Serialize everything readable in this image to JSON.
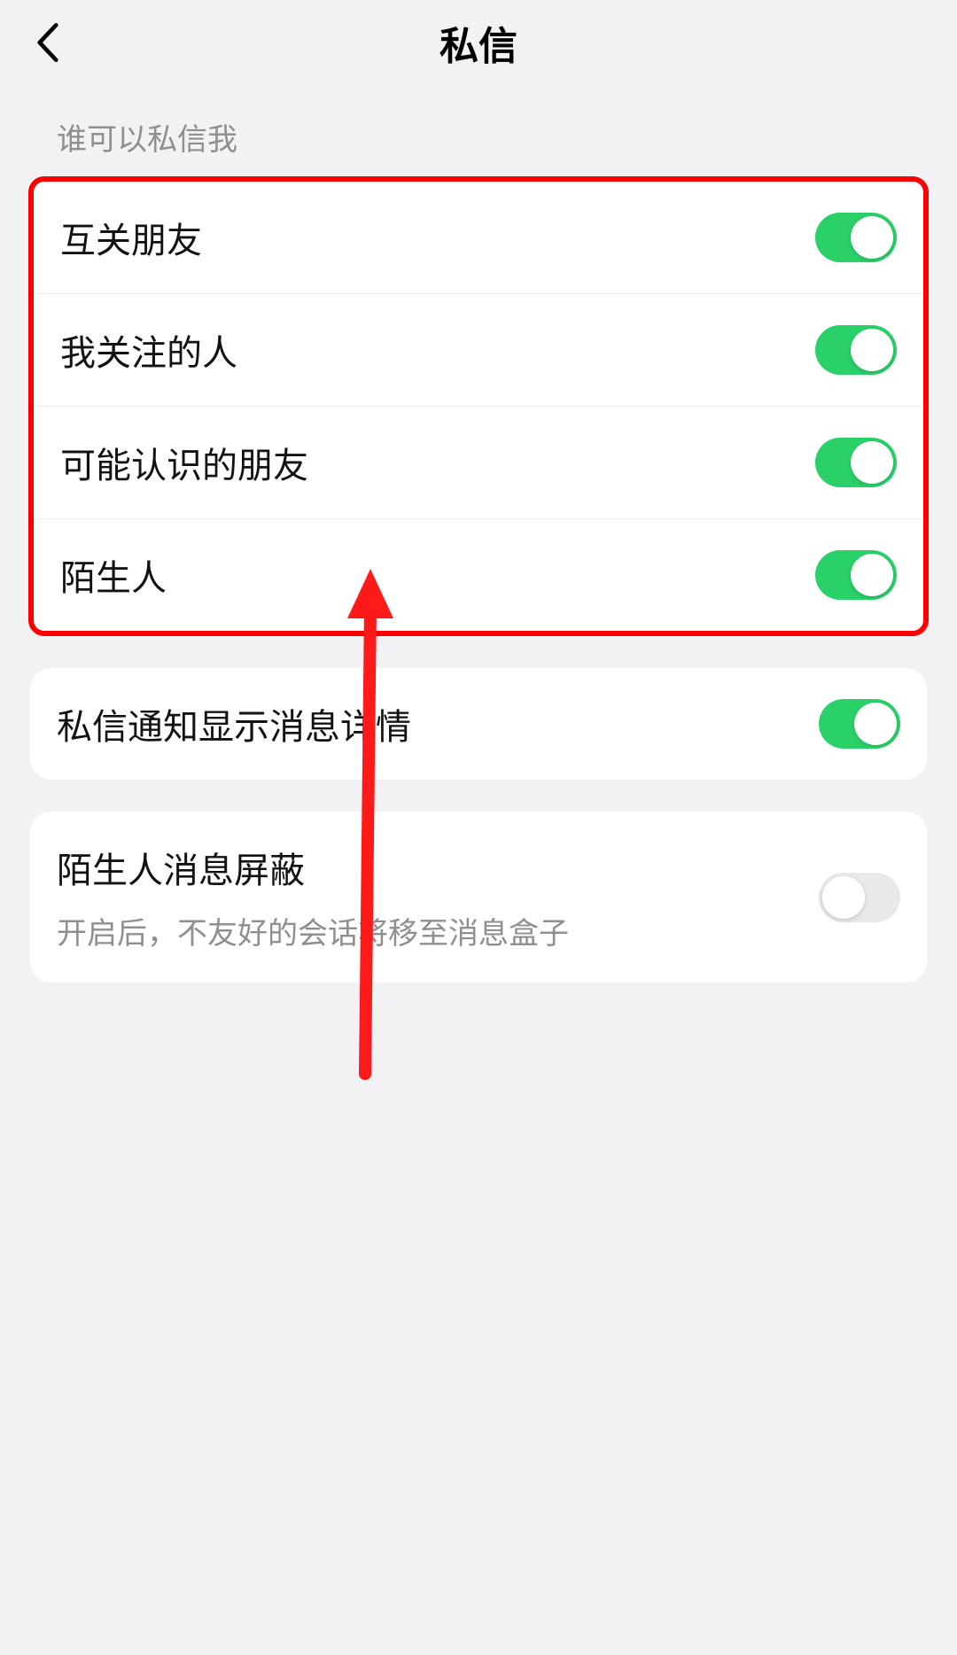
{
  "header": {
    "title": "私信"
  },
  "section1": {
    "label": "谁可以私信我",
    "rows": [
      {
        "label": "互关朋友",
        "on": true
      },
      {
        "label": "我关注的人",
        "on": true
      },
      {
        "label": "可能认识的朋友",
        "on": true
      },
      {
        "label": "陌生人",
        "on": true
      }
    ]
  },
  "section2": {
    "rows": [
      {
        "label": "私信通知显示消息详情",
        "on": true
      }
    ]
  },
  "section3": {
    "rows": [
      {
        "label": "陌生人消息屏蔽",
        "sublabel": "开启后，不友好的会话将移至消息盒子",
        "on": false
      }
    ]
  },
  "annotation": {
    "arrow_color": "#ff1a1a",
    "highlight_color": "#ff0000"
  }
}
